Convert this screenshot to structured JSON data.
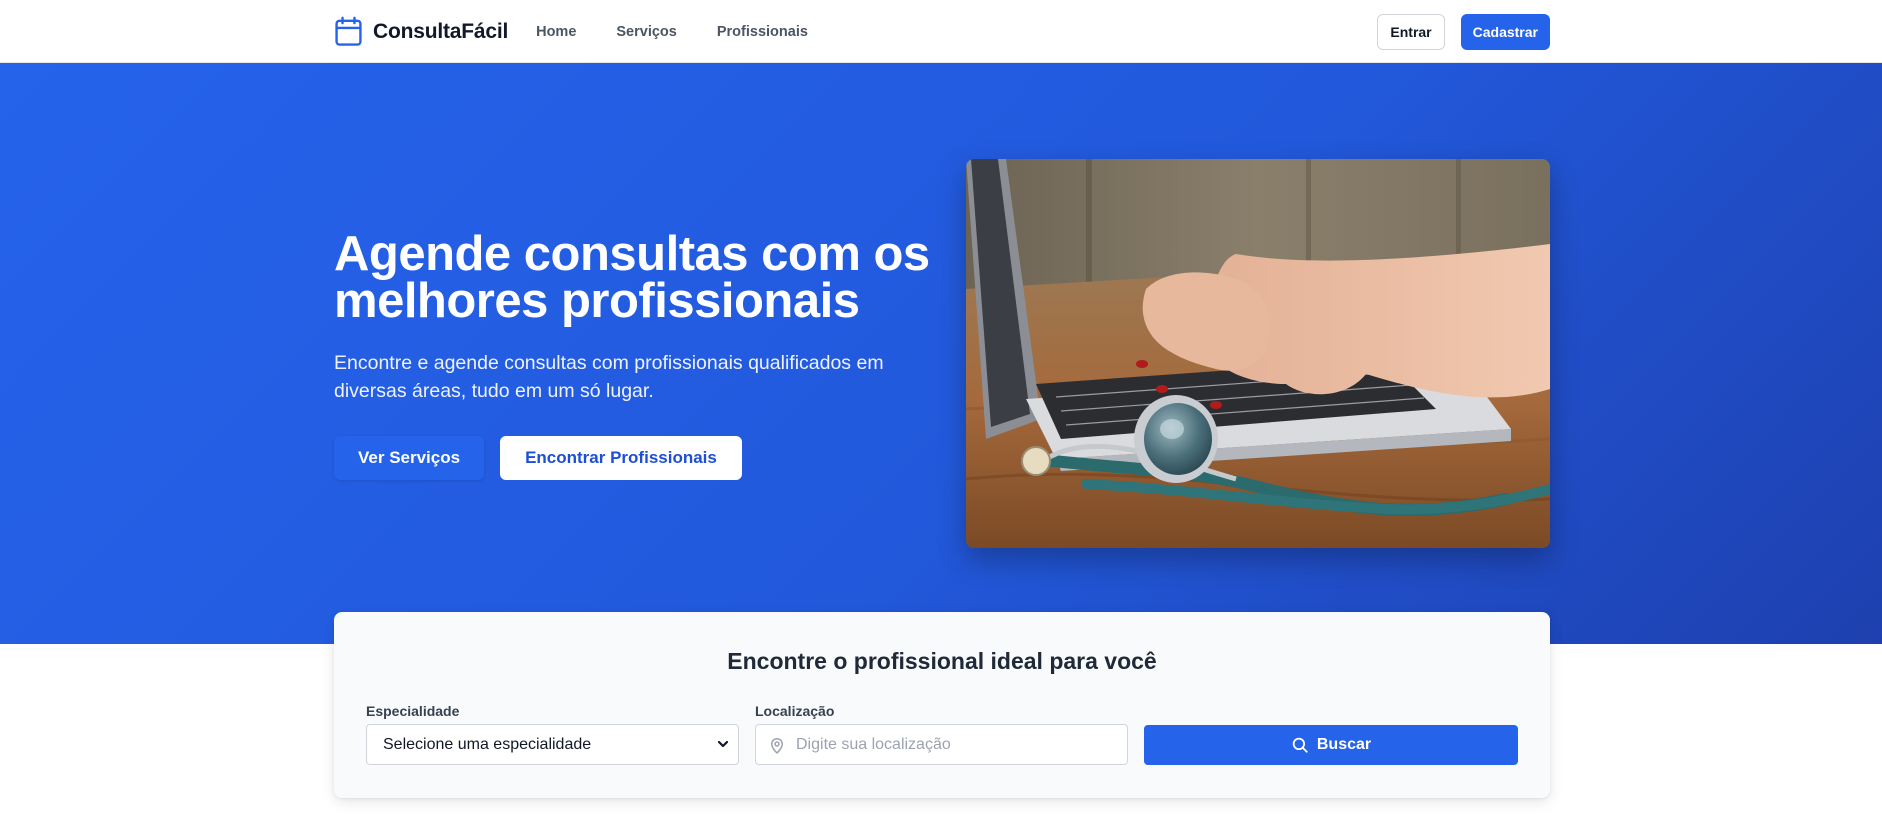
{
  "navbar": {
    "brand": "ConsultaFácil",
    "links": [
      "Home",
      "Serviços",
      "Profissionais"
    ],
    "login_label": "Entrar",
    "signup_label": "Cadastrar"
  },
  "hero": {
    "title": "Agende consultas com os melhores profissionais",
    "subtitle": "Encontre e agende consultas com profissionais qualificados em diversas áreas, tudo em um só lugar.",
    "primary_button": "Ver Serviços",
    "secondary_button": "Encontrar Profissionais"
  },
  "search": {
    "title": "Encontre o profissional ideal para você",
    "specialty_label": "Especialidade",
    "specialty_value": "Selecione uma especialidade",
    "location_label": "Localização",
    "location_placeholder": "Digite sua localização",
    "button_label": "Buscar"
  },
  "colors": {
    "primary": "#2563eb",
    "hero_gradient_end": "#1e40af"
  },
  "icons": {
    "brand": "calendar-icon",
    "location": "map-pin-icon",
    "search": "search-icon",
    "select": "chevron-down-icon"
  }
}
